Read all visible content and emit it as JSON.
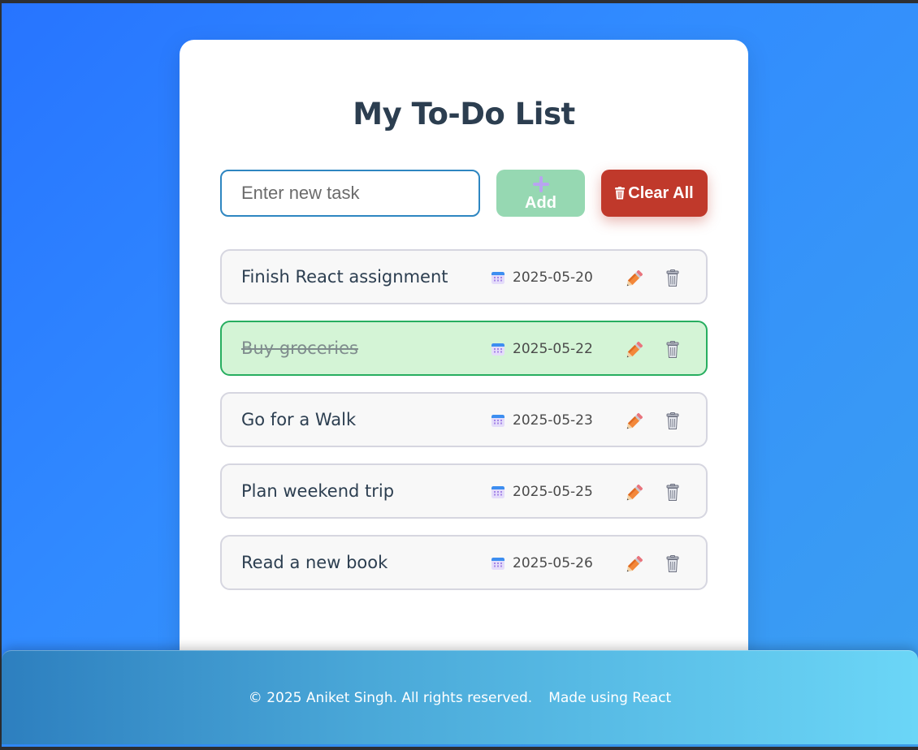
{
  "app": {
    "title": "My To-Do List"
  },
  "input": {
    "placeholder": "Enter new task",
    "value": ""
  },
  "buttons": {
    "add_label": "Add",
    "add_icon": "plus-icon",
    "clear_label": "Clear All",
    "clear_icon": "trash-icon"
  },
  "tasks": [
    {
      "text": "Finish React assignment",
      "date": "2025-05-20",
      "completed": false
    },
    {
      "text": "Buy groceries",
      "date": "2025-05-22",
      "completed": true
    },
    {
      "text": "Go for a Walk",
      "date": "2025-05-23",
      "completed": false
    },
    {
      "text": "Plan weekend trip",
      "date": "2025-05-25",
      "completed": false
    },
    {
      "text": "Read a new book",
      "date": "2025-05-26",
      "completed": false
    }
  ],
  "task_icons": {
    "date": "calendar-icon",
    "edit": "pencil-icon",
    "delete": "trash-icon"
  },
  "footer": {
    "copyright": "© 2025 Aniket Singh. All rights reserved.",
    "made_with": "Made using React"
  },
  "colors": {
    "add_button": "#96d8b2",
    "clear_button": "#c0392b",
    "completed_bg": "#d4f4d6",
    "completed_border": "#27ae60",
    "title": "#2c3e50"
  }
}
